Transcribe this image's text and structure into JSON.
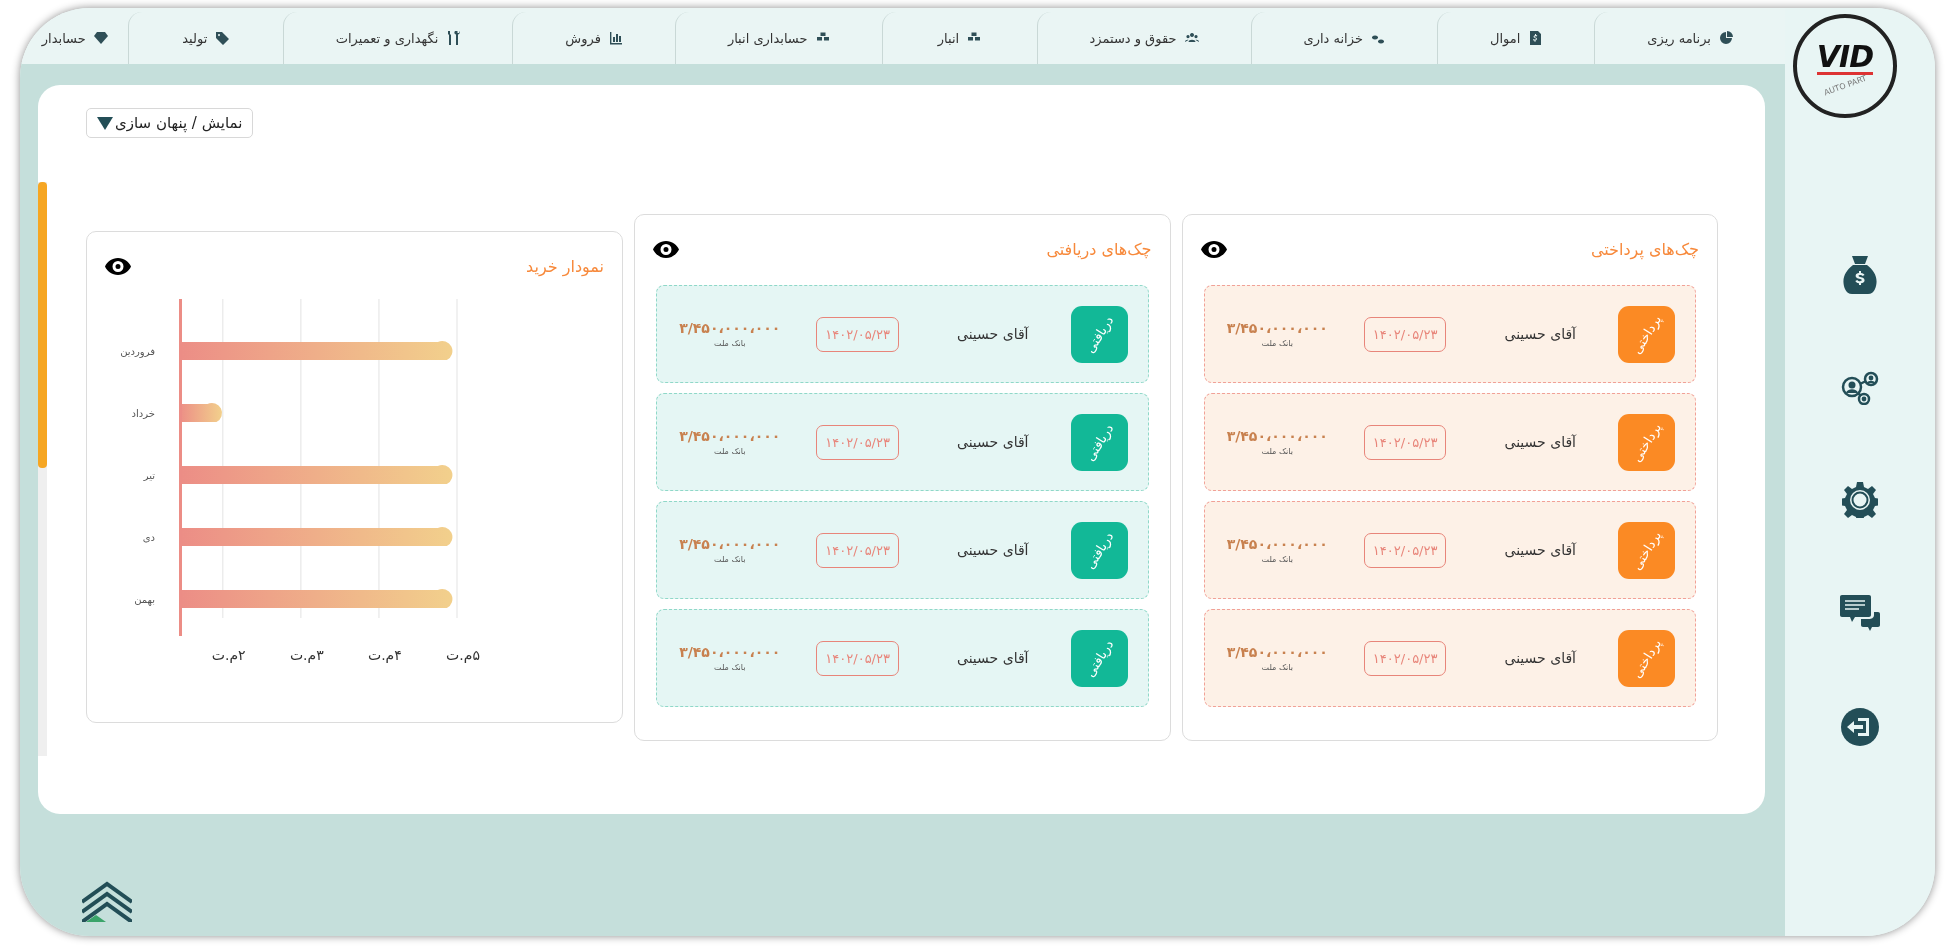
{
  "logo": {
    "name": "VID",
    "tagline": "AUTO PART"
  },
  "tabs": [
    {
      "label": "برنامه ریزی",
      "selected": false
    },
    {
      "label": "اموال",
      "selected": false
    },
    {
      "label": "خزانه داری",
      "selected": false
    },
    {
      "label": "حقوق و دستمزد",
      "selected": false
    },
    {
      "label": "انبار",
      "selected": false
    },
    {
      "label": "حسابداری انبار",
      "selected": false
    },
    {
      "label": "فروش",
      "selected": false
    },
    {
      "label": "نگهداری و تعمیرات",
      "selected": false
    },
    {
      "label": "تولید",
      "selected": false
    },
    {
      "label": "حسابدار",
      "selected": false
    }
  ],
  "toggle_button": {
    "label": "نمایش / پنهان سازی"
  },
  "panels": [
    {
      "kind": "payable",
      "title": "چک‌های پرداختی",
      "checks": [
        {
          "status": "پرداختی",
          "name": "آقای حسینی",
          "date": "۱۴۰۲/۰۵/۲۳",
          "amount": "۳/۴۵۰،۰۰۰،۰۰۰",
          "bank": "بانک ملت"
        },
        {
          "status": "پرداختی",
          "name": "آقای حسینی",
          "date": "۱۴۰۲/۰۵/۲۳",
          "amount": "۳/۴۵۰،۰۰۰،۰۰۰",
          "bank": "بانک ملت"
        },
        {
          "status": "پرداختی",
          "name": "آقای حسینی",
          "date": "۱۴۰۲/۰۵/۲۳",
          "amount": "۳/۴۵۰،۰۰۰،۰۰۰",
          "bank": "بانک ملت"
        },
        {
          "status": "پرداختی",
          "name": "آقای حسینی",
          "date": "۱۴۰۲/۰۵/۲۳",
          "amount": "۳/۴۵۰،۰۰۰،۰۰۰",
          "bank": "بانک ملت"
        }
      ]
    },
    {
      "kind": "receivable",
      "title": "چک‌های دریافتی",
      "checks": [
        {
          "status": "دریافتی",
          "name": "آقای حسینی",
          "date": "۱۴۰۲/۰۵/۲۳",
          "amount": "۳/۴۵۰،۰۰۰،۰۰۰",
          "bank": "بانک ملت"
        },
        {
          "status": "دریافتی",
          "name": "آقای حسینی",
          "date": "۱۴۰۲/۰۵/۲۳",
          "amount": "۳/۴۵۰،۰۰۰،۰۰۰",
          "bank": "بانک ملت"
        },
        {
          "status": "دریافتی",
          "name": "آقای حسینی",
          "date": "۱۴۰۲/۰۵/۲۳",
          "amount": "۳/۴۵۰،۰۰۰،۰۰۰",
          "bank": "بانک ملت"
        },
        {
          "status": "دریافتی",
          "name": "آقای حسینی",
          "date": "۱۴۰۲/۰۵/۲۳",
          "amount": "۳/۴۵۰،۰۰۰،۰۰۰",
          "bank": "بانک ملت"
        }
      ]
    },
    {
      "kind": "chart",
      "title": "نمودار خرید",
      "chart_data": {
        "type": "bar",
        "orientation": "horizontal",
        "categories": [
          "فروردین",
          "خرداد",
          "تیر",
          "دی",
          "بهمن"
        ],
        "values": [
          4.87,
          1.92,
          4.87,
          4.87,
          4.87
        ],
        "xlim": [
          1.44,
          5
        ],
        "xticks": [
          {
            "value": 2,
            "label": "۲م.ت"
          },
          {
            "value": 3,
            "label": "۳م.ت"
          },
          {
            "value": 4,
            "label": "۴م.ت"
          },
          {
            "value": 5,
            "label": "۵م.ت"
          }
        ]
      }
    }
  ]
}
